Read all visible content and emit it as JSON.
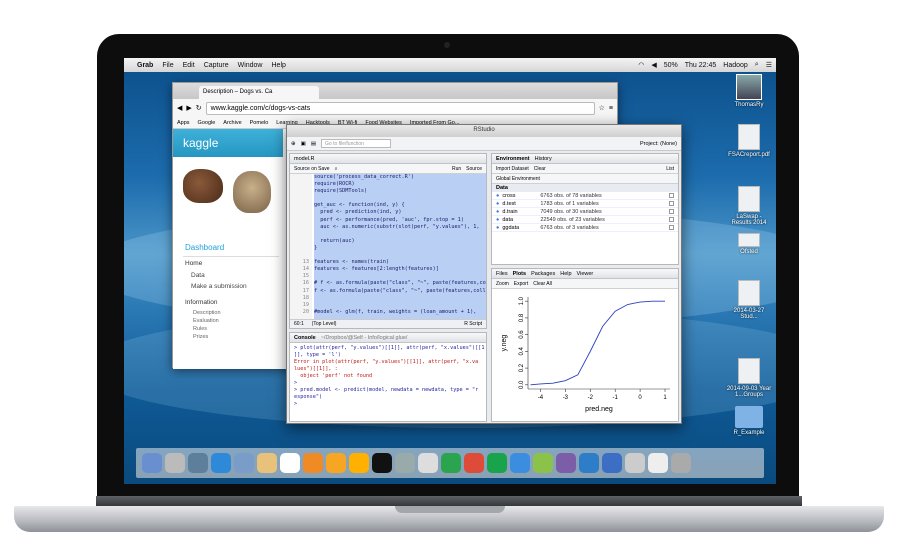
{
  "menubar": {
    "app": "Grab",
    "items": [
      "File",
      "Edit",
      "Capture",
      "Window",
      "Help"
    ],
    "battery": "50%",
    "clock": "Thu 22:45",
    "user": "Hadoop"
  },
  "desktop": {
    "icons": [
      "ThomasRy",
      "FSACreport.pdf",
      "LaSwap - Results 2014",
      "Ofsted",
      "2014-03-27 Stud...",
      "2014-09-03 Year 1...Groups",
      "R_Example"
    ]
  },
  "browser": {
    "tab_title": "Description – Dogs vs. Ca",
    "url": "www.kaggle.com/c/dogs-vs-cats",
    "bookmarks": [
      "Apps",
      "Google",
      "Archive",
      "Pomelo",
      "Learning",
      "Hacktools",
      "BT Wi-fi",
      "Food Websites",
      "Imported From Go..."
    ],
    "kaggle": {
      "logo": "kaggle",
      "sidebar": {
        "title": "Dashboard",
        "items": [
          "Home",
          "Data",
          "Make a submission"
        ],
        "info_title": "Information",
        "info_items": [
          "Description",
          "Evaluation",
          "Rules",
          "Prizes"
        ]
      }
    }
  },
  "rstudio": {
    "title": "RStudio",
    "goto_placeholder": "Go to file/function",
    "project": "Project: (None)",
    "editor": {
      "file_tab": "model.R",
      "source_on_save": "Source on Save",
      "run": "Run",
      "source": "Source",
      "line_numbers": [
        "",
        "",
        "",
        "",
        "",
        "",
        "",
        "",
        "",
        "",
        "",
        "",
        "13",
        "14",
        "15",
        "16",
        "17",
        "18",
        "19",
        "20"
      ],
      "lines": [
        "source('process_data_correct.R')",
        "require(ROCR)",
        "require(SDMTools)",
        "",
        "get_auc <- function(ind, y) {",
        "  pred <- prediction(ind, y)",
        "  perf <- performance(pred, 'auc', fpr.stop = 1)",
        "  auc <- as.numeric(substr(slot(perf, \"y.values\"), 1,",
        "",
        "  return(auc)",
        "}",
        "",
        "features <- names(train)",
        "features <- features[2:length(features)]",
        "",
        "# f <- as.formula(paste(\"class\", \"~\", paste(features,co",
        "f <- as.formula(paste(\"class\", \"~\", paste(features,coll",
        "",
        "",
        "#model <- glm(f, train, weights = (loan_amount + 1),"
      ],
      "status_pos": "60:1",
      "status_scope": "(Top Level)",
      "status_type": "R Script"
    },
    "console": {
      "title": "Console",
      "path": "~/Dropbox/@Self - Info/logical glue/",
      "lines": [
        "> plot(attr(perf, \"y.values\")[[1]], attr(perf, \"x.values\")[[1",
        "]], type = 'l')",
        "Error in plot(attr(perf, \"y.values\")[[1]], attr(perf, \"x.va",
        "lues\")[[1]], :",
        "  object 'perf' not found",
        ">",
        "> pred.model <- predict(model, newdata = newdata, type = \"r",
        "esponse\")",
        ">"
      ]
    },
    "environment": {
      "tabs": [
        "Environment",
        "History"
      ],
      "import": "Import Dataset",
      "clear": "Clear",
      "list": "List",
      "scope": "Global Environment",
      "section": "Data",
      "rows": [
        {
          "name": "cross",
          "desc": "6763 obs. of 78 variables"
        },
        {
          "name": "d.test",
          "desc": "1783 obs. of 1 variables"
        },
        {
          "name": "d.train",
          "desc": "7049 obs. of 30 variables"
        },
        {
          "name": "data",
          "desc": "22549 obs. of 23 variables"
        },
        {
          "name": "ggdata",
          "desc": "6763 obs. of 3 variables"
        }
      ]
    },
    "plots": {
      "tabs": [
        "Files",
        "Plots",
        "Packages",
        "Help",
        "Viewer"
      ],
      "zoom": "Zoom",
      "export": "Export",
      "clear_all": "Clear All"
    }
  },
  "chart_data": {
    "type": "line",
    "xlabel": "pred.neg",
    "ylabel": "y.neg",
    "xlim": [
      -4.5,
      1.2
    ],
    "ylim": [
      -0.05,
      1.05
    ],
    "x_ticks": [
      "-4",
      "-3",
      "-2",
      "-1",
      "0",
      "1"
    ],
    "y_ticks": [
      "0.0",
      "0.2",
      "0.4",
      "0.6",
      "0.8",
      "1.0"
    ],
    "x": [
      -4.4,
      -4,
      -3.5,
      -3,
      -2.5,
      -2,
      -1.5,
      -1,
      -0.5,
      0,
      0.5,
      1
    ],
    "y": [
      0.0,
      0.01,
      0.02,
      0.05,
      0.12,
      0.4,
      0.7,
      0.88,
      0.96,
      0.99,
      1.0,
      1.0
    ],
    "color": "#2a3fbf"
  }
}
